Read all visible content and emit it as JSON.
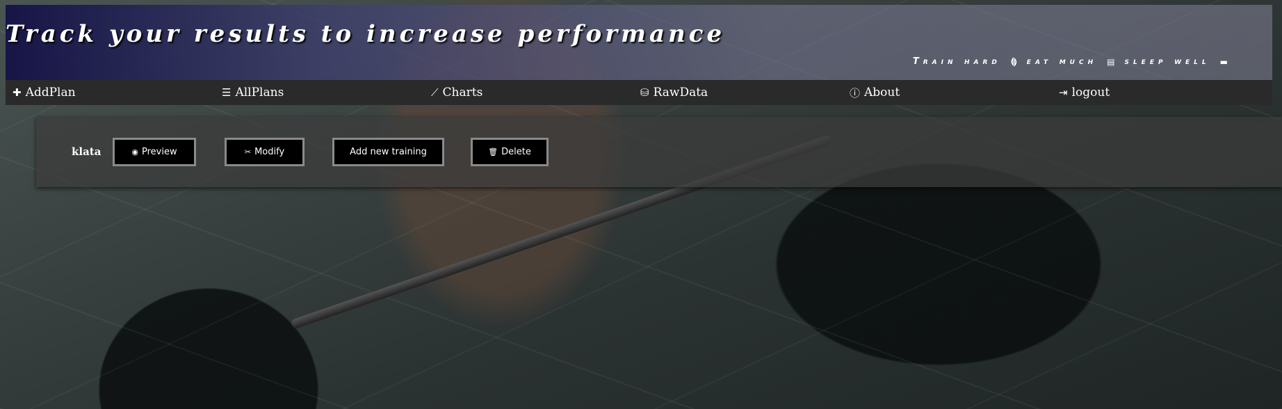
{
  "header": {
    "tagline": "Track your results to increase performance",
    "motto": [
      {
        "text": "Train hard",
        "icon": "dumbbell-icon",
        "glyph": "⟬⟭"
      },
      {
        "text": "eat much",
        "icon": "food-icon",
        "glyph": "▤"
      },
      {
        "text": "sleep well",
        "icon": "bed-icon",
        "glyph": "▬"
      }
    ]
  },
  "nav": {
    "items": [
      {
        "label": "AddPlan",
        "icon": "plus-icon",
        "glyph": "✚"
      },
      {
        "label": "AllPlans",
        "icon": "list-icon",
        "glyph": "☰"
      },
      {
        "label": "Charts",
        "icon": "line-chart-icon",
        "glyph": "⟋"
      },
      {
        "label": "RawData",
        "icon": "database-icon",
        "glyph": "⛁"
      },
      {
        "label": "About",
        "icon": "info-icon",
        "glyph": "ⓘ"
      },
      {
        "label": "logout",
        "icon": "logout-icon",
        "glyph": "⇥"
      }
    ]
  },
  "plan": {
    "name": "klata",
    "buttons": {
      "preview": {
        "label": "Preview",
        "icon": "eye-icon",
        "glyph": "◉"
      },
      "modify": {
        "label": "Modify",
        "icon": "tools-icon",
        "glyph": "✂"
      },
      "add_training": {
        "label": "Add new training"
      },
      "delete": {
        "label": "Delete",
        "icon": "trash-icon",
        "glyph": "🗑"
      }
    }
  }
}
